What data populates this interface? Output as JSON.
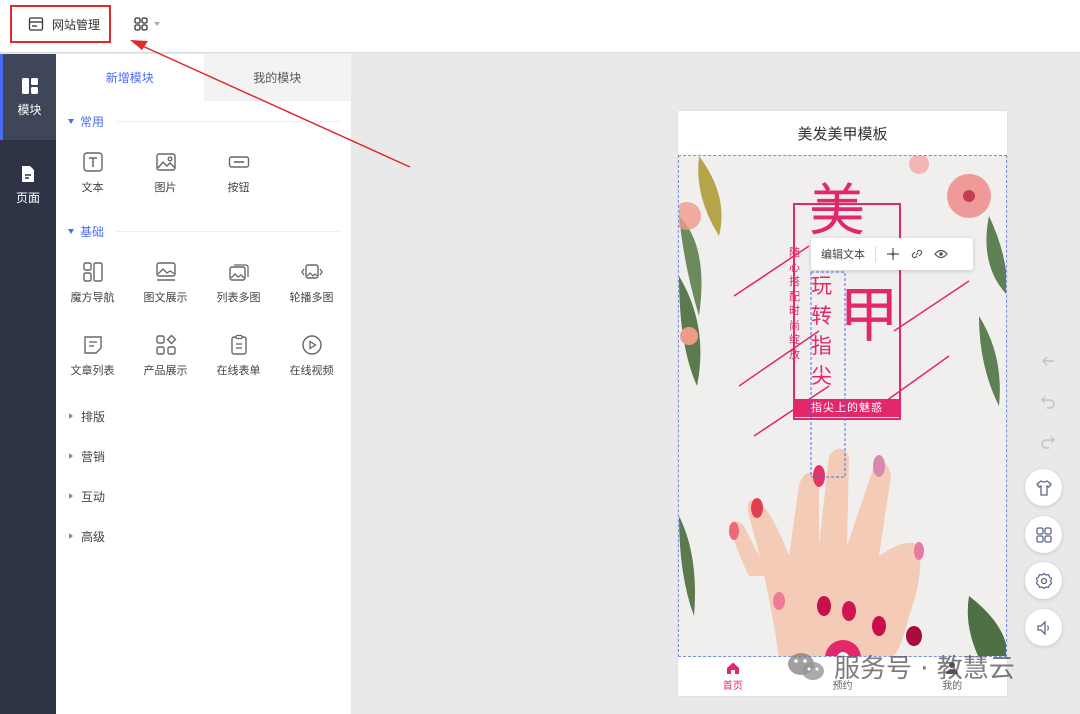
{
  "topbar": {
    "site_management": "网站管理"
  },
  "rail": [
    {
      "label": "模块",
      "icon": "layout-blocks-icon"
    },
    {
      "label": "页面",
      "icon": "page-icon"
    }
  ],
  "panel": {
    "tabs": [
      "新增模块",
      "我的模块"
    ],
    "sections": [
      {
        "title": "常用",
        "items": [
          "文本",
          "图片",
          "按钮"
        ]
      },
      {
        "title": "基础",
        "items": [
          "魔方导航",
          "图文展示",
          "列表多图",
          "轮播多图",
          "文章列表",
          "产品展示",
          "在线表单",
          "在线视频"
        ]
      }
    ],
    "collapsed": [
      "排版",
      "营销",
      "互动",
      "高级"
    ]
  },
  "phone": {
    "title": "美发美甲模板",
    "poster": {
      "big_top": "美",
      "big_bottom": "甲",
      "vertical_small": "随心搭配时尚绽放",
      "vertical_main": "玩转指尖",
      "banner": "指尖上的魅惑"
    },
    "nav": [
      "首页",
      "预约",
      "我的"
    ]
  },
  "edit_toolbar": {
    "label": "编辑文本"
  },
  "watermark": "服务号 · 教慧云",
  "colors": {
    "accent": "#4a6cf7",
    "highlight": "#e0292b",
    "poster_pink": "#e2286a",
    "rail": "#2e3446"
  }
}
